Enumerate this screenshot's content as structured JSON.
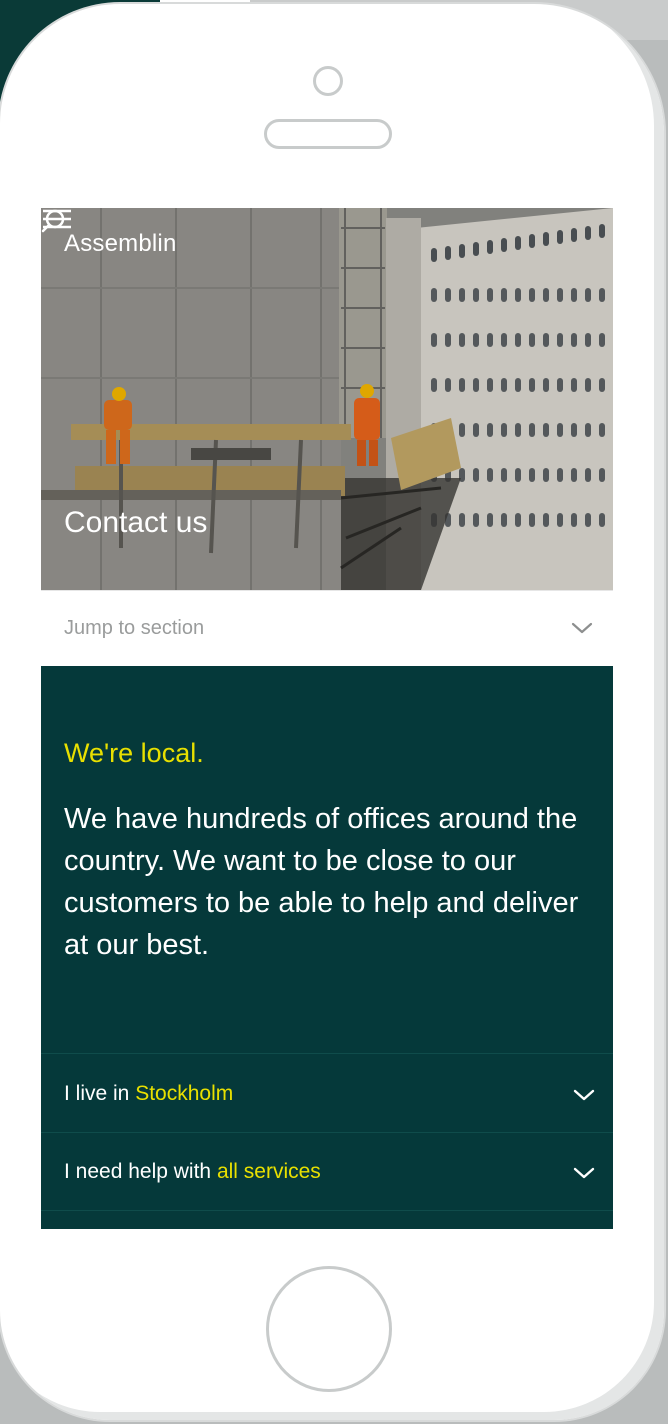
{
  "header": {
    "brand": "Assemblin",
    "search_icon": "search-icon",
    "menu_icon": "hamburger-menu-icon"
  },
  "hero": {
    "title": "Contact us"
  },
  "jump": {
    "label": "Jump to section",
    "icon": "chevron-down-icon"
  },
  "local": {
    "heading": "We're local.",
    "text": "We have hundreds of offices around the country. We want to be close to our customers to be able to help and deliver at our best."
  },
  "filters": [
    {
      "prefix": "I live in ",
      "value": "Stockholm"
    },
    {
      "prefix": "I need help with ",
      "value": "all services"
    }
  ],
  "colors": {
    "brand_dark_green": "#05393a",
    "accent_yellow": "#e8e000",
    "text_white": "#ffffff"
  }
}
